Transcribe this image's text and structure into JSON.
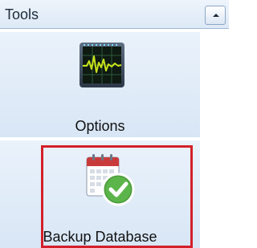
{
  "panel": {
    "title": "Tools",
    "collapse_button_icon": "chevron-up-icon",
    "items": [
      {
        "label": "Options",
        "icon": "oscilloscope-icon"
      },
      {
        "label": "Backup Database",
        "icon": "calendar-check-icon"
      }
    ]
  },
  "colors": {
    "highlight": "#d3202a",
    "header_bg": "#dde9f6",
    "pane_bg": "#e2edf8",
    "waveform": "#c8e21a"
  }
}
